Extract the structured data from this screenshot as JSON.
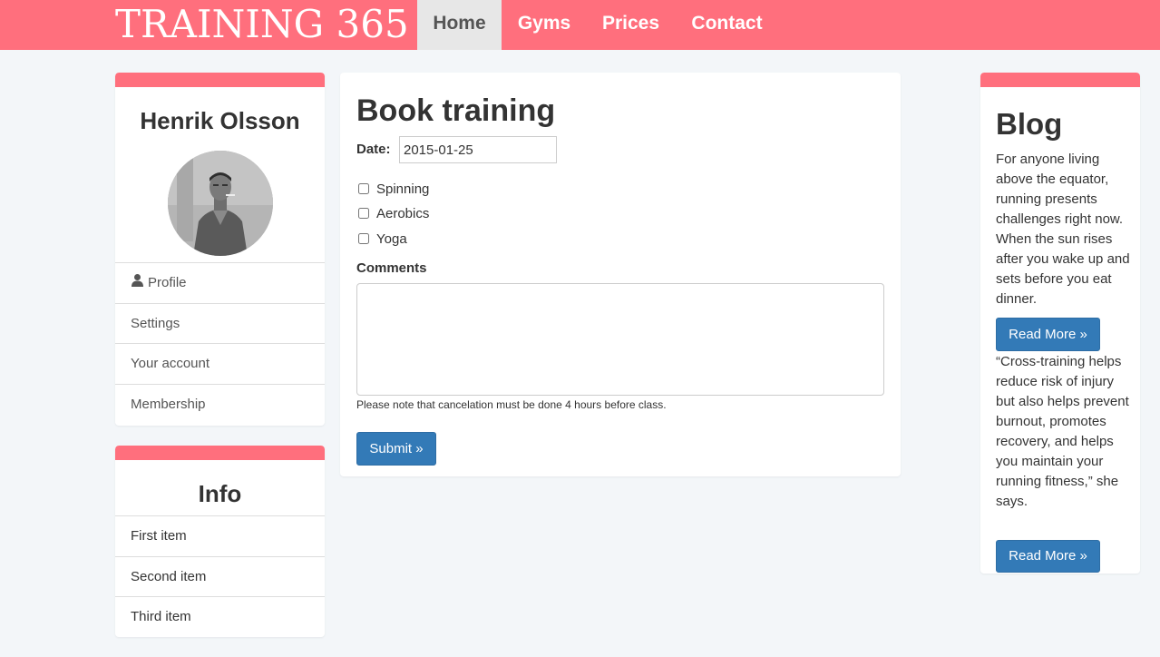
{
  "brand": "TRAINING 365",
  "nav": {
    "items": [
      {
        "label": "Home",
        "active": true
      },
      {
        "label": "Gyms",
        "active": false
      },
      {
        "label": "Prices",
        "active": false
      },
      {
        "label": "Contact",
        "active": false
      }
    ]
  },
  "colors": {
    "accent": "#ff6f7d",
    "primary_button": "#337ab7",
    "background": "#f3f6f9",
    "active_nav": "#e7e7e7"
  },
  "profile": {
    "name": "Henrik Olsson",
    "menu": [
      {
        "label": "Profile",
        "icon": "user-icon"
      },
      {
        "label": "Settings"
      },
      {
        "label": "Your account"
      },
      {
        "label": "Membership"
      }
    ]
  },
  "info": {
    "title": "Info",
    "items": [
      "First item",
      "Second item",
      "Third item"
    ]
  },
  "booking": {
    "title": "Book training",
    "date_label": "Date:",
    "date_value": "2015-01-25",
    "options": [
      "Spinning",
      "Aerobics",
      "Yoga"
    ],
    "comments_label": "Comments",
    "comments_value": "",
    "note": "Please note that cancelation must be done 4 hours before class.",
    "submit_label": "Submit »"
  },
  "blog": {
    "title": "Blog",
    "paragraph_1": "For anyone living above the equator, running presents challenges right now. When the sun rises after you wake up and sets before you eat dinner.",
    "read_more_1": "Read More »",
    "paragraph_2": "“Cross-training helps reduce risk of injury but also helps prevent burnout, promotes recovery, and helps you maintain your running fitness,” she says.",
    "read_more_2": "Read More »"
  }
}
